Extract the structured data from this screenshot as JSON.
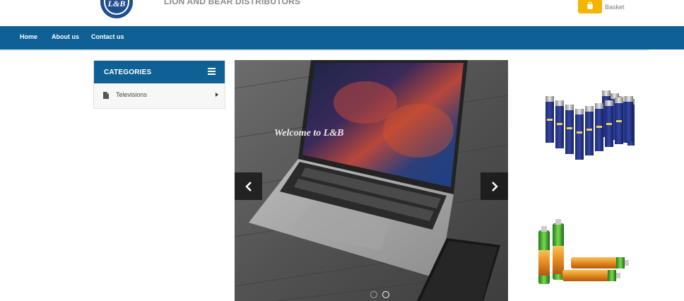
{
  "header": {
    "brand_name": "LION AND BEAR DISTRIBUTORS",
    "logo_text": "L&B",
    "basket_label": "Basket",
    "accent_color": "#0e6095",
    "basket_color": "#f4b400"
  },
  "nav": {
    "items": [
      {
        "label": "Home"
      },
      {
        "label": "About us"
      },
      {
        "label": "Contact us"
      }
    ]
  },
  "categories": {
    "title": "CATEGORIES",
    "menu_icon": "bars-icon",
    "items": [
      {
        "label": "Televisions",
        "icon": "file-icon",
        "submenu_icon": "caret-right-icon"
      }
    ]
  },
  "slider": {
    "caption": "Welcome to L&B",
    "prev_icon": "chevron-left-icon",
    "next_icon": "chevron-right-icon",
    "total_slides": 2,
    "active_slide": 2
  },
  "products": [
    {
      "name": "rayovac-aa-batteries-image",
      "brand_text": "RAYOVAC"
    },
    {
      "name": "gp-super-batteries-image",
      "brand_text": "GP Super"
    }
  ]
}
